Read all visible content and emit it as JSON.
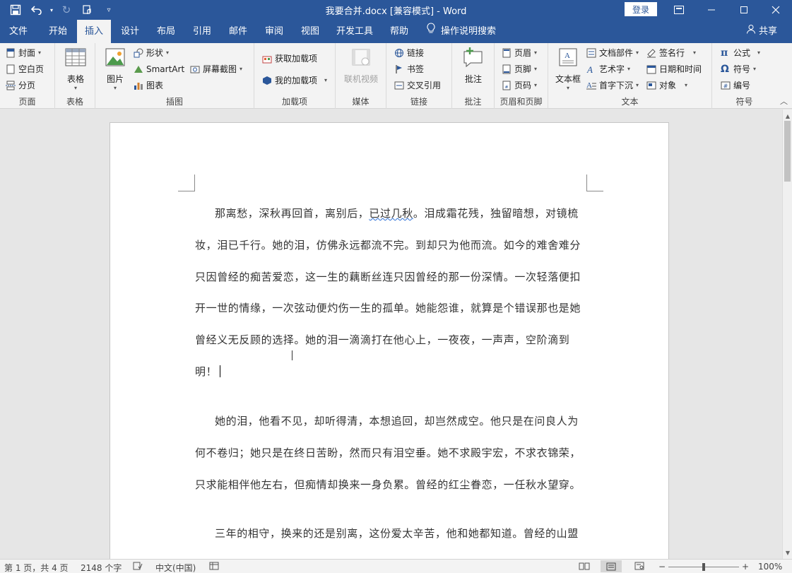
{
  "window": {
    "title": "我要合并.docx [兼容模式]  -  Word",
    "login": "登录"
  },
  "tabs": [
    "文件",
    "开始",
    "插入",
    "设计",
    "布局",
    "引用",
    "邮件",
    "审阅",
    "视图",
    "开发工具",
    "帮助"
  ],
  "tell_me": "操作说明搜索",
  "share": "共享",
  "ribbon": {
    "page": {
      "label": "页面",
      "cover": "封面",
      "blank": "空白页",
      "break": "分页"
    },
    "table": {
      "label": "表格",
      "table": "表格"
    },
    "illus": {
      "label": "插图",
      "picture": "图片",
      "shapes": "形状",
      "smartart": "SmartArt",
      "chart": "图表",
      "screenshot": "屏幕截图"
    },
    "addins": {
      "label": "加载项",
      "get": "获取加载项",
      "mine": "我的加载项"
    },
    "media": {
      "label": "媒体",
      "video": "联机视频"
    },
    "links": {
      "label": "链接",
      "link": "链接",
      "bookmark": "书签",
      "xref": "交叉引用"
    },
    "comments": {
      "label": "批注",
      "comment": "批注"
    },
    "hf": {
      "label": "页眉和页脚",
      "header": "页眉",
      "footer": "页脚",
      "pagenum": "页码"
    },
    "text": {
      "label": "文本",
      "textbox": "文本框",
      "parts": "文档部件",
      "wordart": "艺术字",
      "dropcap": "首字下沉",
      "sigline": "签名行",
      "datetime": "日期和时间",
      "object": "对象"
    },
    "symbols": {
      "label": "符号",
      "equation": "公式",
      "symbol": "符号",
      "number": "编号"
    }
  },
  "document": {
    "p1_before": "那离愁，深秋再回首，离别后，",
    "p1_underlined": "已过几秋",
    "p1_after": "。泪成霜花残，独留暗想，对镜梳妆，泪已千行。她的泪，仿佛永远都流不完。到却只为他而流。如今的难舍难分只因曾经的痴苦爱恋，这一生的藕断丝连只因曾经的那一份深情。一次轻落便扣开一世的情缘，一次弦动便灼伤一生的孤单。她能怨谁，就算是个错误那也是她曾经义无反顾的选择。她的泪一滴滴打在他心上，一夜夜，一声声，空阶滴到明！",
    "p2": "她的泪，他看不见，却听得清，本想追回，却岂然成空。他只是在问良人为何不卷归；她只是在终日苦盼，然而只有泪空垂。她不求殿宇宏，不求衣锦荣，只求能相伴他左右，但痴情却换来一身负累。曾经的红尘眷恋，一任秋水望穿。",
    "p3": "三年的相守，换来的还是别离，这份爱太辛苦，他和她都知道。曾经的山盟"
  },
  "status": {
    "page": "第 1 页，共 4 页",
    "words": "2148 个字",
    "language": "中文(中国)",
    "zoom": "100%"
  },
  "colors": {
    "brand": "#2b579a"
  }
}
